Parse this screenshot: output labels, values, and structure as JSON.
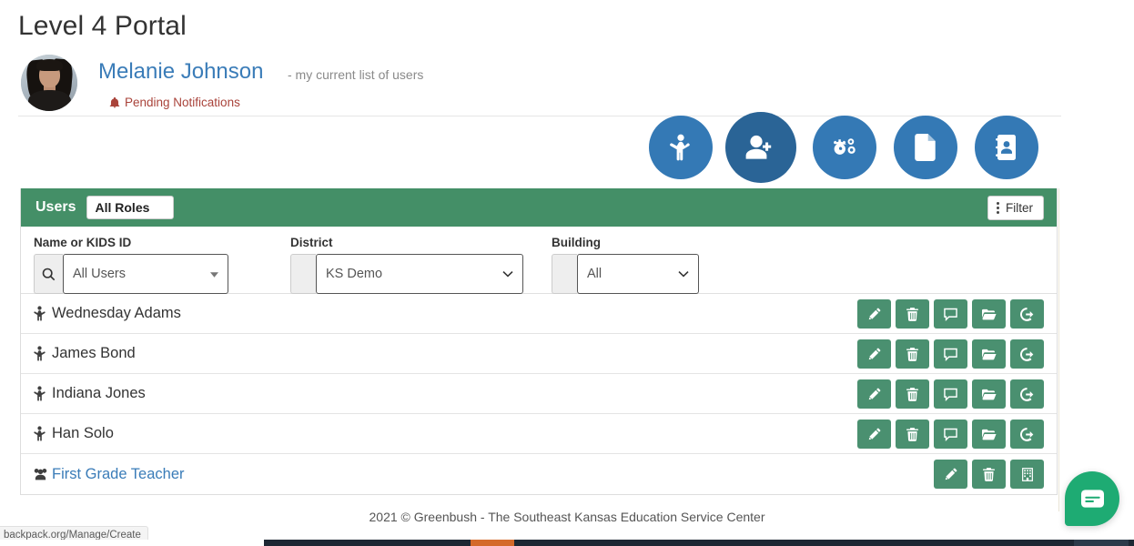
{
  "page": {
    "title": "Level 4 Portal"
  },
  "identity": {
    "name": "Melanie Johnson",
    "subtitle": "- my current list of users",
    "notifications_label": "Pending Notifications",
    "notification_color": "#a9433a",
    "name_color": "#3a7cb8",
    "avatar_alt": "Melanie Johnson profile photo"
  },
  "quick_actions": [
    {
      "name": "student-icon",
      "label": "Students",
      "color": "#3479b5"
    },
    {
      "name": "add-user-icon",
      "label": "Add User",
      "color": "#2a6496"
    },
    {
      "name": "cogs-icon",
      "label": "Settings",
      "color": "#3479b5"
    },
    {
      "name": "document-icon",
      "label": "Documents",
      "color": "#3479b5"
    },
    {
      "name": "address-book-icon",
      "label": "Contacts",
      "color": "#3479b5"
    }
  ],
  "panel": {
    "title": "Users",
    "header_color": "#448f67",
    "role_select": {
      "value": "All Roles",
      "options": [
        "All Roles"
      ]
    },
    "filter_button": {
      "label": "Filter",
      "icon": "kebab-menu-icon"
    }
  },
  "filters": [
    {
      "id": "name-or-kids-id",
      "label": "Name or KIDS ID",
      "icon": "search-icon",
      "value": "All Users",
      "placeholder": "All Users",
      "caret": "caret-down-icon"
    },
    {
      "id": "district",
      "label": "District",
      "icon": "",
      "value": "KS Demo",
      "placeholder": "KS Demo",
      "caret": "chevron-down-icon"
    },
    {
      "id": "building",
      "label": "Building",
      "icon": "",
      "value": "All",
      "placeholder": "All",
      "caret": "chevron-down-icon"
    }
  ],
  "table": {
    "action_color": "#4a9070",
    "rows": [
      {
        "name": "Wednesday Adams",
        "type": "student",
        "icon": "child-icon",
        "is_link": false,
        "actions": [
          "edit-icon",
          "delete-icon",
          "comment-icon",
          "folder-open-icon",
          "sign-out-icon"
        ]
      },
      {
        "name": "James Bond",
        "type": "student",
        "icon": "child-icon",
        "is_link": false,
        "actions": [
          "edit-icon",
          "delete-icon",
          "comment-icon",
          "folder-open-icon",
          "sign-out-icon"
        ]
      },
      {
        "name": "Indiana Jones",
        "type": "student",
        "icon": "child-icon",
        "is_link": false,
        "actions": [
          "edit-icon",
          "delete-icon",
          "comment-icon",
          "folder-open-icon",
          "sign-out-icon"
        ]
      },
      {
        "name": "Han Solo",
        "type": "student",
        "icon": "child-icon",
        "is_link": false,
        "actions": [
          "edit-icon",
          "delete-icon",
          "comment-icon",
          "folder-open-icon",
          "sign-out-icon"
        ]
      },
      {
        "name": "First Grade Teacher",
        "type": "group",
        "icon": "users-group-icon",
        "is_link": true,
        "actions": [
          "edit-icon",
          "delete-icon",
          "building-icon"
        ]
      }
    ]
  },
  "footer": {
    "text": "2021 © Greenbush - The Southeast Kansas Education Service Center"
  },
  "status_bar": {
    "url": "backpack.org/Manage/Create"
  },
  "chat_widget": {
    "icon": "chat-message-icon",
    "color": "#1eab73"
  }
}
